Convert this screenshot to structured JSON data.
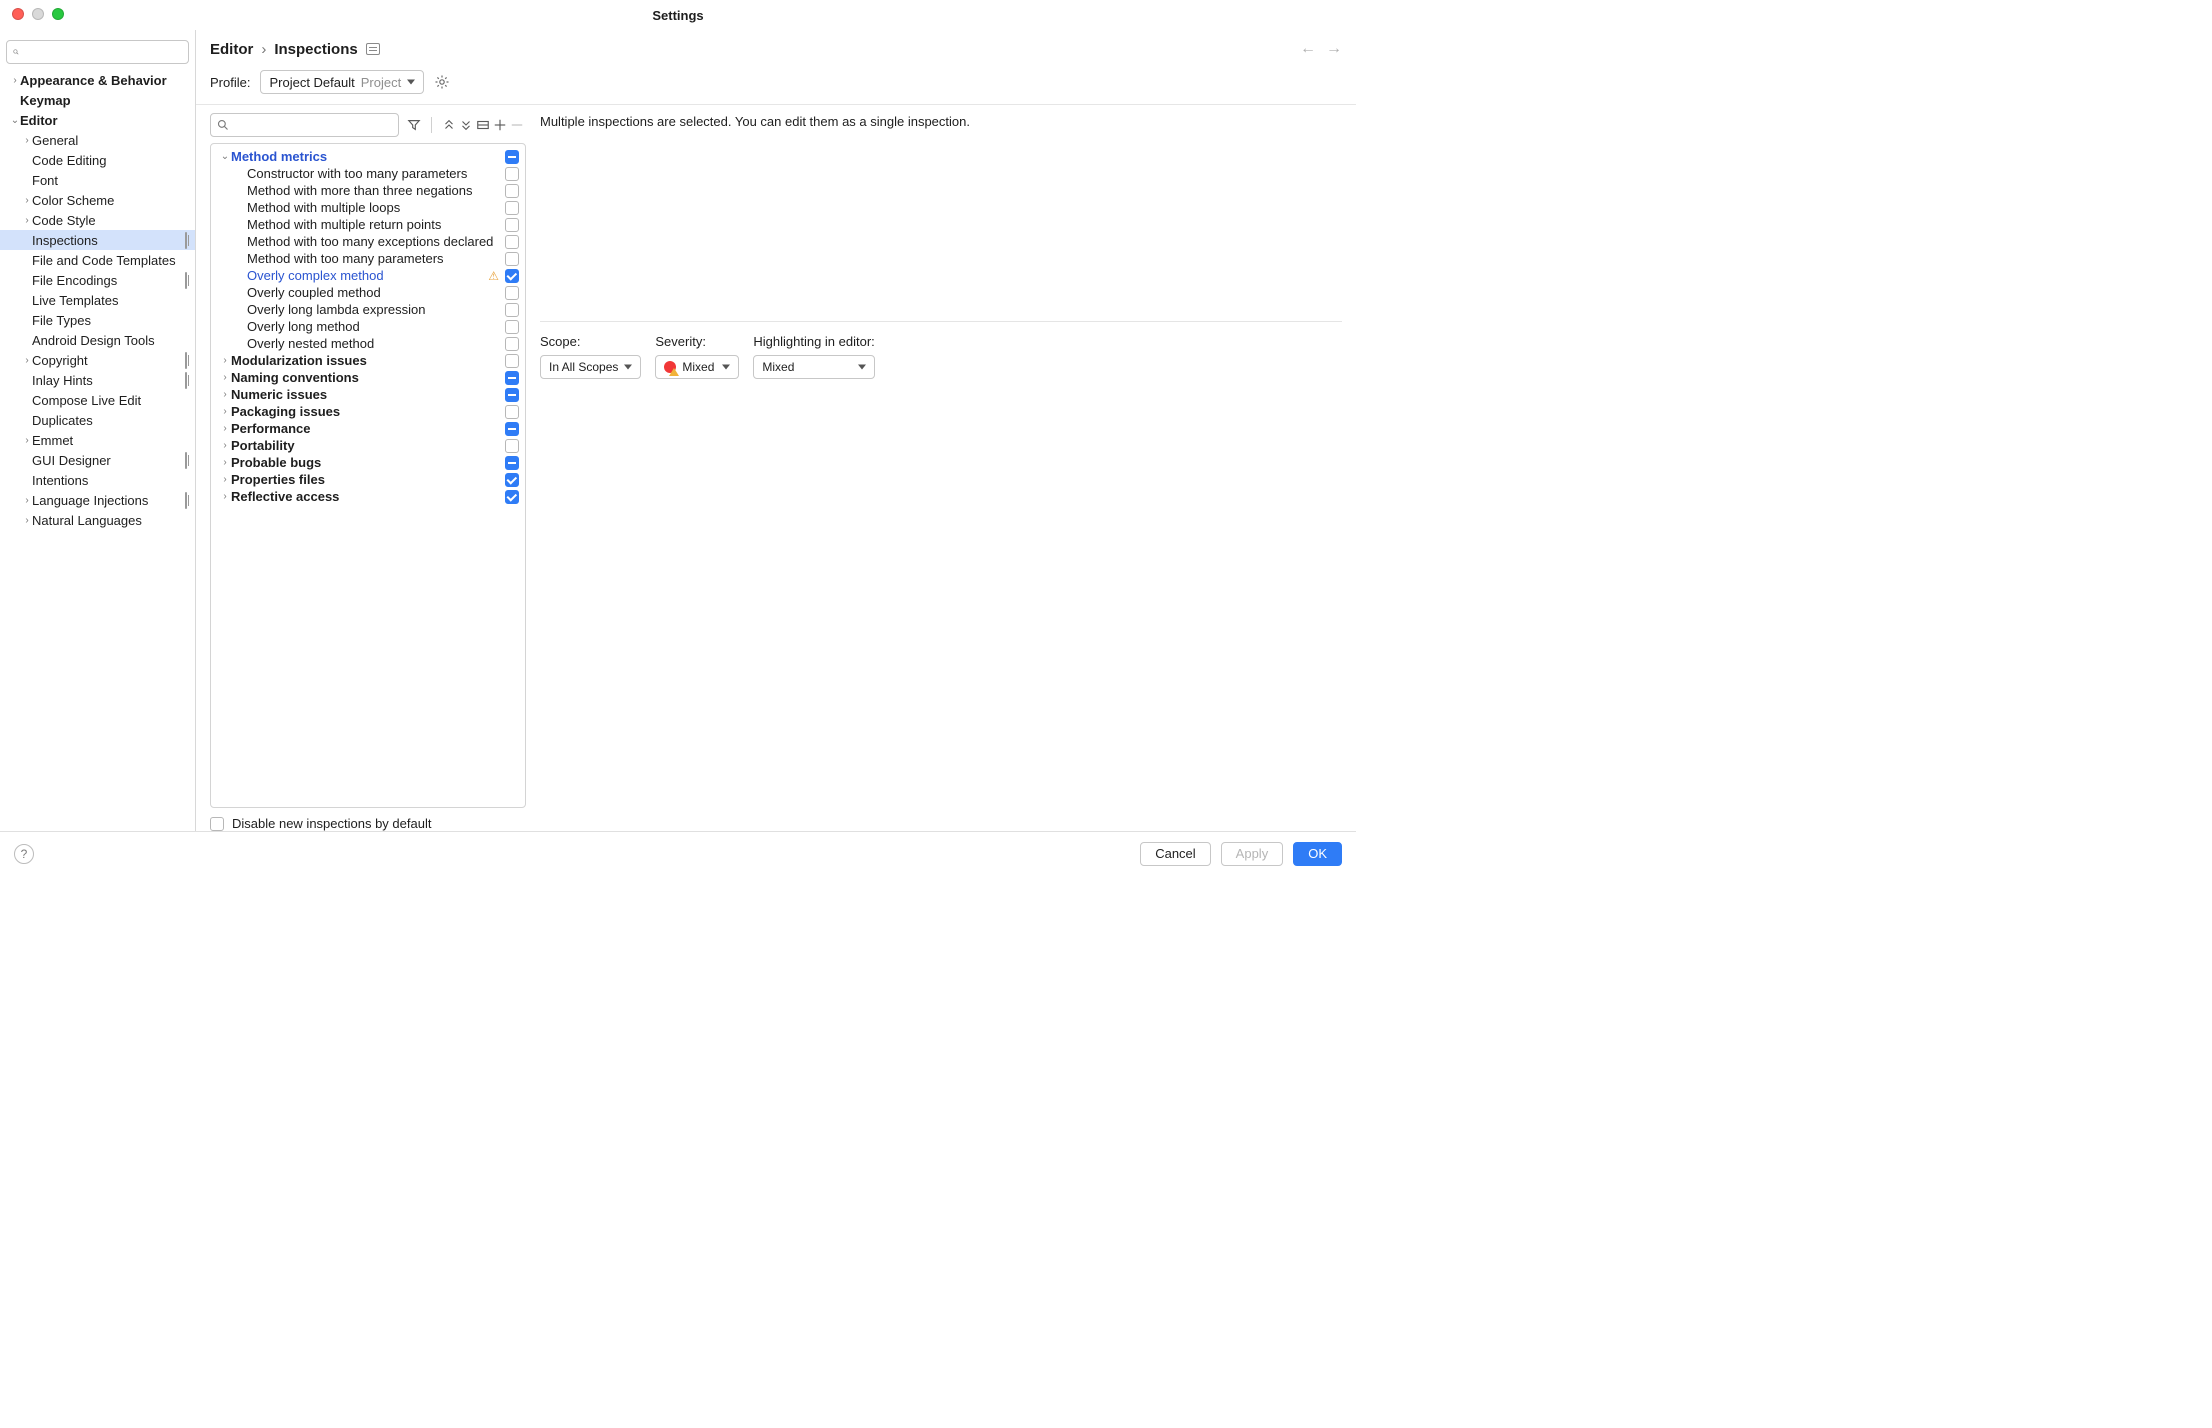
{
  "window": {
    "title": "Settings"
  },
  "sidebar": {
    "search_placeholder": "",
    "items": [
      {
        "label": "Appearance & Behavior",
        "depth": 0,
        "chev": "›",
        "bold": true
      },
      {
        "label": "Keymap",
        "depth": 0,
        "chev": "",
        "bold": true
      },
      {
        "label": "Editor",
        "depth": 0,
        "chev": "⌄",
        "bold": true
      },
      {
        "label": "General",
        "depth": 1,
        "chev": "›"
      },
      {
        "label": "Code Editing",
        "depth": 1,
        "chev": ""
      },
      {
        "label": "Font",
        "depth": 1,
        "chev": ""
      },
      {
        "label": "Color Scheme",
        "depth": 1,
        "chev": "›"
      },
      {
        "label": "Code Style",
        "depth": 1,
        "chev": "›"
      },
      {
        "label": "Inspections",
        "depth": 1,
        "chev": "",
        "selected": true,
        "badge": true
      },
      {
        "label": "File and Code Templates",
        "depth": 1,
        "chev": ""
      },
      {
        "label": "File Encodings",
        "depth": 1,
        "chev": "",
        "badge": true
      },
      {
        "label": "Live Templates",
        "depth": 1,
        "chev": ""
      },
      {
        "label": "File Types",
        "depth": 1,
        "chev": ""
      },
      {
        "label": "Android Design Tools",
        "depth": 1,
        "chev": ""
      },
      {
        "label": "Copyright",
        "depth": 1,
        "chev": "›",
        "badge": true
      },
      {
        "label": "Inlay Hints",
        "depth": 1,
        "chev": "",
        "badge": true
      },
      {
        "label": "Compose Live Edit",
        "depth": 1,
        "chev": ""
      },
      {
        "label": "Duplicates",
        "depth": 1,
        "chev": ""
      },
      {
        "label": "Emmet",
        "depth": 1,
        "chev": "›"
      },
      {
        "label": "GUI Designer",
        "depth": 1,
        "chev": "",
        "badge": true
      },
      {
        "label": "Intentions",
        "depth": 1,
        "chev": ""
      },
      {
        "label": "Language Injections",
        "depth": 1,
        "chev": "›",
        "badge": true
      },
      {
        "label": "Natural Languages",
        "depth": 1,
        "chev": "›"
      }
    ]
  },
  "breadcrumb": {
    "seg1": "Editor",
    "seg2": "Inspections"
  },
  "profile": {
    "label": "Profile:",
    "value": "Project Default",
    "scope": "Project"
  },
  "inspections_search_placeholder": "",
  "tree": [
    {
      "label": "Method metrics",
      "group": true,
      "blue": true,
      "chev": "⌄",
      "depth": 0,
      "state": "indet"
    },
    {
      "label": "Constructor with too many parameters",
      "depth": 1,
      "state": "off"
    },
    {
      "label": "Method with more than three negations",
      "depth": 1,
      "state": "off"
    },
    {
      "label": "Method with multiple loops",
      "depth": 1,
      "state": "off"
    },
    {
      "label": "Method with multiple return points",
      "depth": 1,
      "state": "off"
    },
    {
      "label": "Method with too many exceptions declared",
      "depth": 1,
      "state": "off"
    },
    {
      "label": "Method with too many parameters",
      "depth": 1,
      "state": "off"
    },
    {
      "label": "Overly complex method",
      "depth": 1,
      "state": "checked",
      "blue": true,
      "warn": true
    },
    {
      "label": "Overly coupled method",
      "depth": 1,
      "state": "off"
    },
    {
      "label": "Overly long lambda expression",
      "depth": 1,
      "state": "off"
    },
    {
      "label": "Overly long method",
      "depth": 1,
      "state": "off"
    },
    {
      "label": "Overly nested method",
      "depth": 1,
      "state": "off"
    },
    {
      "label": "Modularization issues",
      "group": true,
      "chev": "›",
      "depth": 0,
      "state": "off"
    },
    {
      "label": "Naming conventions",
      "group": true,
      "chev": "›",
      "depth": 0,
      "state": "indet"
    },
    {
      "label": "Numeric issues",
      "group": true,
      "chev": "›",
      "depth": 0,
      "state": "indet"
    },
    {
      "label": "Packaging issues",
      "group": true,
      "chev": "›",
      "depth": 0,
      "state": "off"
    },
    {
      "label": "Performance",
      "group": true,
      "chev": "›",
      "depth": 0,
      "state": "indet"
    },
    {
      "label": "Portability",
      "group": true,
      "chev": "›",
      "depth": 0,
      "state": "off"
    },
    {
      "label": "Probable bugs",
      "group": true,
      "chev": "›",
      "depth": 0,
      "state": "indet"
    },
    {
      "label": "Properties files",
      "group": true,
      "chev": "›",
      "depth": 0,
      "state": "checked"
    },
    {
      "label": "Reflective access",
      "group": true,
      "chev": "›",
      "depth": 0,
      "state": "checked"
    }
  ],
  "disable_label": "Disable new inspections by default",
  "details": {
    "message": "Multiple inspections are selected. You can edit them as a single inspection.",
    "scope": {
      "label": "Scope:",
      "value": "In All Scopes"
    },
    "severity": {
      "label": "Severity:",
      "value": "Mixed"
    },
    "highlight": {
      "label": "Highlighting in editor:",
      "value": "Mixed"
    }
  },
  "footer": {
    "cancel": "Cancel",
    "apply": "Apply",
    "ok": "OK"
  }
}
